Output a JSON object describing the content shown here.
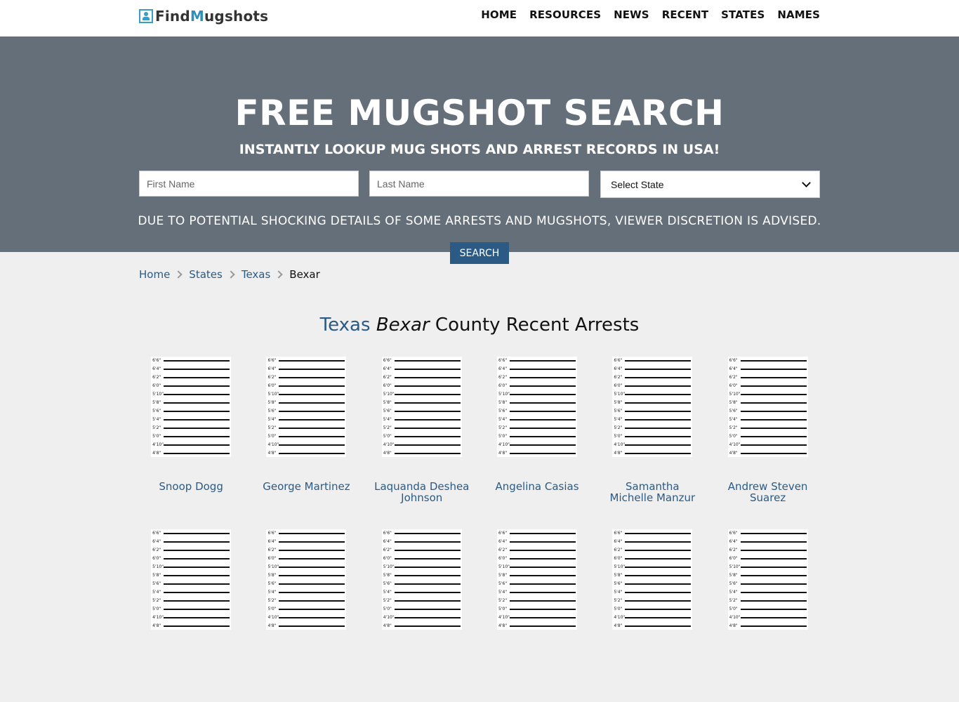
{
  "site": {
    "logo_left": "Find",
    "logo_accent": "M",
    "logo_right": "ugshots",
    "nav": [
      "HOME",
      "RESOURCES",
      "NEWS",
      "RECENT",
      "STATES",
      "NAMES"
    ]
  },
  "hero": {
    "title": "FREE MUGSHOT SEARCH",
    "subtitle": "INSTANTLY LOOKUP MUG SHOTS AND ARREST RECORDS IN USA!",
    "first_name_placeholder": "First Name",
    "last_name_placeholder": "Last Name",
    "state_select_value": "Select State",
    "warning": "DUE TO POTENTIAL SHOCKING DETAILS OF SOME ARRESTS AND MUGSHOTS, VIEWER DISCRETION IS ADVISED.",
    "search_label": "SEARCH"
  },
  "breadcrumb": {
    "home": "Home",
    "states": "States",
    "state": "Texas",
    "county": "Bexar"
  },
  "section": {
    "state": "Texas",
    "county": "Bexar",
    "rest": "County Recent Arrests"
  },
  "mugshot_height_labels": [
    "6'6\"",
    "6'4\"",
    "6'2\"",
    "6'0\"",
    "5'10\"",
    "5'8\"",
    "5'6\"",
    "5'4\"",
    "5'2\"",
    "5'0\"",
    "4'10\"",
    "4'8\""
  ],
  "arrests": [
    {
      "name": "Snoop Dogg"
    },
    {
      "name": "George Martinez"
    },
    {
      "name": "Laquanda Deshea Johnson"
    },
    {
      "name": "Angelina Casias"
    },
    {
      "name": "Samantha Michelle Manzur"
    },
    {
      "name": "Andrew Steven Suarez"
    },
    {
      "name": ""
    },
    {
      "name": ""
    },
    {
      "name": ""
    },
    {
      "name": ""
    },
    {
      "name": ""
    },
    {
      "name": ""
    }
  ]
}
